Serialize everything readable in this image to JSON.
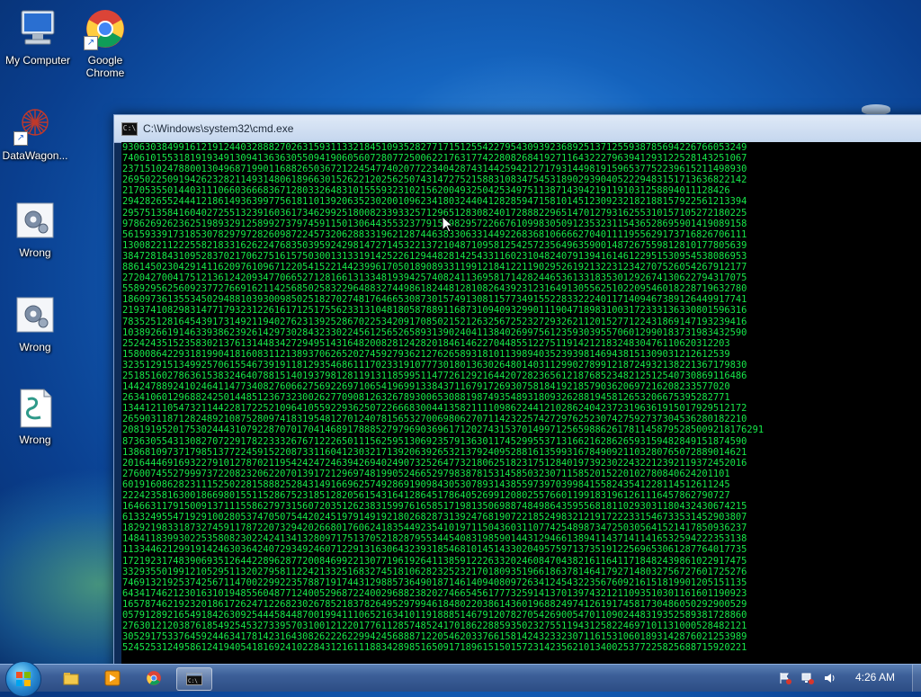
{
  "desktop_icons": [
    {
      "label": "My Computer",
      "icon": "computer-icon"
    },
    {
      "label": "Google Chrome",
      "icon": "chrome-icon"
    },
    {
      "label": "DataWagon...",
      "icon": "datawagon-icon"
    },
    {
      "label": "Wrong",
      "icon": "settings-gear-icon"
    },
    {
      "label": "Wrong",
      "icon": "settings-gear-icon"
    },
    {
      "label": "Wrong",
      "icon": "script-file-icon"
    }
  ],
  "cmd_window": {
    "title": "C:\\Windows\\system32\\cmd.exe",
    "console_lines": [
      "930630384991612191244032888270263159311332184510935282771715125542279543093923689251371255938785694226766053249",
      "740610155318191934913094136363055094190605607280772500622176317742280826841927116432227963941293122528143251067",
      "237151024788001304968719901168826503672122454774020772234042874314425942127179314498191596537752239615211498930",
      "269502250919426232821149314806189663015262212025625074314727521588310834754531890293904052229483151713636822142",
      "217053550144031110660366683671280332648310155593231021562004932504253497511387143942191191031258894011128426",
      "294282655244412186149363997756181101392063523020010962341803244041282859471581014512309232182188157922561213394",
      "295751358416040272551323916036173462992518008233933257129651283082401728882296514701279316255310157105272180225",
      "978626926236251989329125899273797459115013064435532377915498295722667610998305091235323115436528695901419089158",
      "561593391731853078297972826098722457320628833196212874463833063314492268368106666270401111955629173716826706111",
      "130082211222558218331626224768350395924298147271453221372104871095812542572356496359001487267559812810177805639",
      "384728184310952837021706275161575030013133191425226129448281425433116023104824079139416146122951530954538086953",
      "886145023042914116209761096712205415221442399617050189089331199121841221190295261921322312342707526054267912177",
      "272042700417512136124209347706652712816613133481939425740824113695817142824465361331835301292674130622794317075",
      "558929562560923772766916211425685025832296488327449861824481281082643923123164913055625102209546018228719632780",
      "186097361355345029488103930098502518270274817646653087301574913081157734915522833222401171409467389126449917741",
      "219374108298314771793231226161712517556233131048180587889116873109409329901119047189831003172333136330801596316",
      "783525128164543917314921194027623139252867022534209170850215212632567252327293262112015277122431869147193239416",
      "103892661914633938623926142973028432330224561256526589313902404113840269975612359303955706012990183731983432590",
      "252424351523583021376131448342729495143164820082812428201846146227044855122751191421218324830476110620312203",
      "158008642293181990418160831121389370626520274592793621276265893181011398940352393981469438151309031212612539",
      "323512915134992570615546739191181293546861117023319107773018013630264801403112990278991218724932138221367179830",
      "251851602786361538324640788151401937981281191311859951147726129216442072823656121876852348212512540730869116486",
      "144247889241024641147734082760662756922697106541969913384371167917269307581841921857903620697216208233577020",
      "263410601296882425014485123673230026277090812632678930065308819874935489318093262881945812653206675395282771",
      "134412110547321144228172252109641055922936250722666830044135821111098622441210286240423723196361915017929512172",
      "265903118712824892108752809741831954812701240781565327006980627071142322574272976252307427592737304536280182210",
      "208191952017530244431079228707017041468917888527979690369617120274315370149971256598862617811458795285009218176291",
      "873630554313082707229178223332676712226501115625951306923579136301174529955371316621628626593159482849151874590",
      "138681097371798513772245915220873311604123032171392063926532137924095288161359931678490921103280765072889014621",
      "201644469169322791012787021195424247246394269402490732526477321806251823175128401973923022432212392119372452016",
      "276007455279997372208232062207013917212969748199052466529798387815314585032307115852015220102780840624201101",
      "601916086282311152502281588825284314916696257492869190984305307893143855973970399841558243541228114512611245",
      "222423581630018669801551152867523185128205615431641286451786405269912080255766011991831961261116457862790727",
      "164663117915009137111558627973156072035126238315997616585171981350698874849864359556818110293031180432430674215",
      "613324955471929100280537470507544202451979149192180268287313924768190722185249832121917222331546733531452903807",
      "182921983318732745911787220732942026680176062418354492354101971150436031107742548987347250305641521417850936237",
      "148411839930225358082302242413413280971751370521828795534454083198590144312946613894114371411416532594222353138",
      "113344621299191424630364240729349246071229131630643239318546810145143302049575971373519122569653061287764017735",
      "172192317483906935126442289628772008469922130771961926411385912226332024608470438216116411718482439861022917475",
      "332935501991210529511320279581122421332516832745181062823252321701809351966186378146417927148032756727601725276",
      "746913219253742567114700229922357887191744312988573649018714614094080972634124543223567609216151819901205151135",
      "643417462123016310194855604877124005296872240029688238202746654561777325914137013974321211093510301161601190923",
      "165787462192320186172624712268230267852183782649529799461848022038614360196882497412619174581730486050292900529",
      "057912892165491842630925444584487001994111065216341011918885146791207827054269005470110902448319352589381728860",
      "276301212038761854925453273395703100121220177611285748524170186228859350232755119431258224697101131000528482121",
      "305291753376459244634178142316430826222622994245688871220546203376615814243233230711615310601893142876021253989",
      "524525312495861241940541816924102284312161118834289851650917189615150157231423562101340025377225825688715920221"
    ]
  },
  "taskbar": {
    "clock": "4:26 AM",
    "pinned": [
      "windows-explorer-icon",
      "media-player-icon",
      "chrome-icon",
      "cmd-icon"
    ]
  }
}
